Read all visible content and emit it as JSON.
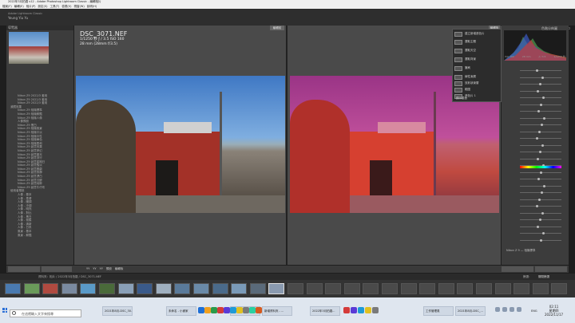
{
  "window": {
    "title": "2022年3月拍攝 v12 - Adobe Photoshop Lightroom Classic - 編輯相片",
    "menu": [
      "檔案(F)",
      "編輯(E)",
      "相片(P)",
      "設定(S)",
      "工具(T)",
      "檢視(V)",
      "視窗(W)",
      "說明(H)"
    ]
  },
  "identity": {
    "line1": "Adobe Lightroom Classic",
    "line2": "Yeung Yiu Yu"
  },
  "modules": [
    "圖庫",
    "編輯相片",
    "地圖",
    "書冊",
    "幻燈片播放",
    "列印",
    "Web"
  ],
  "modules_active": "編輯相片",
  "left_panel": {
    "header": "導覽器",
    "tree": [
      "Nikon Z9 2022/3 套用",
      "Nikon Z9 2022/3 套用",
      "Nikon Z9 2022/3 套用",
      "濾鏡效果",
      "Nikon Z9 相機標準",
      "Nikon Z9 相機鮮豔",
      "Nikon Z9 相機人像",
      "人像預設",
      "Nikon Z9 黑白",
      "Nikon Z9 相機風景",
      "Nikon Z9 相機平淡",
      "Nikon Z9 相機中性",
      "Nikon Z9 相機單色",
      "Nikon Z9 相機柔和",
      "Nikon Z9 創意效果",
      "Nikon Z9 創意夢幻",
      "Nikon Z9 創意晨光",
      "Nikon Z9 創意流行",
      "Nikon Z9 創意星期日",
      "Nikon Z9 創意黯淡",
      "Nikon Z9 創意戲劇",
      "Nikon Z9 創意寂靜",
      "Nikon Z9 創意漂白",
      "Nikon Z9 創意沉鬱",
      "Nikon Z9 創意純粹",
      "Nikon Z9 創意牛仔布",
      "使用者預設",
      "人像 - 基本",
      "人像 - 柔膚",
      "人像 - 暖調",
      "人像 - 冷調",
      "人像 - 明亮",
      "人像 - 對比",
      "人像 - 黑白",
      "人像 - 懷舊",
      "人像 - 清新",
      "人像 - 日系",
      "風景 - 基本",
      "風景 - 鮮豔"
    ],
    "buttons": [
      "複製…",
      "重設"
    ]
  },
  "photo": {
    "filename": "DSC_3071.NEF",
    "exposure": "1/1250 秒   ƒ / 3.5   ISO 160",
    "lens": "28 mm (28mm f/3.5)",
    "before_label": "編輯前",
    "after_label": "編輯後"
  },
  "dropdown": {
    "items": [
      "建立新增遮色片",
      "選取主體",
      "選取天空",
      "選取背景",
      "筆刷",
      "線性漸層",
      "放射狀漸層",
      "範圍",
      "遮色片 1",
      "新增",
      "減去"
    ],
    "show_overlay": "顯示重疊"
  },
  "right_panel": {
    "header": "色階分佈圖",
    "camera_info": [
      "ISO 160",
      "28 mm",
      "ƒ / 3.5",
      "1/1250 秒"
    ],
    "profile": "Nikon Z 9 — 相機標準",
    "buttons": [
      "上一張",
      "重設"
    ]
  },
  "toolbar": {
    "buttons": [
      "YY",
      "YY",
      "YY",
      "預設",
      "編輯後"
    ]
  },
  "filmbar": {
    "path": "資料夾：相片 / 2022年3月拍攝 / DSC_3071.NEF",
    "filter": "篩選：",
    "filter_value": "關閉篩選"
  },
  "taskbar": {
    "search_placeholder": "在這裡輸入文字來搜尋",
    "apps": [
      "2021年8月-DSC_30...",
      "未命名 - 小畫家",
      "未命名 - 小畫家",
      "新增資料夾 - ...",
      "2022年3月拍攝...",
      "工作管理員",
      "2021年8月-DSC_..."
    ],
    "clock_time": "02:11",
    "clock_day": "星期四",
    "clock_date": "2022/11/17",
    "lang": "ENG"
  },
  "colors": {
    "panel": "#3c3c3c",
    "background": "#1e1e1e",
    "mask_overlay": "#c0409a",
    "taskbar": "#dfe6ef"
  }
}
